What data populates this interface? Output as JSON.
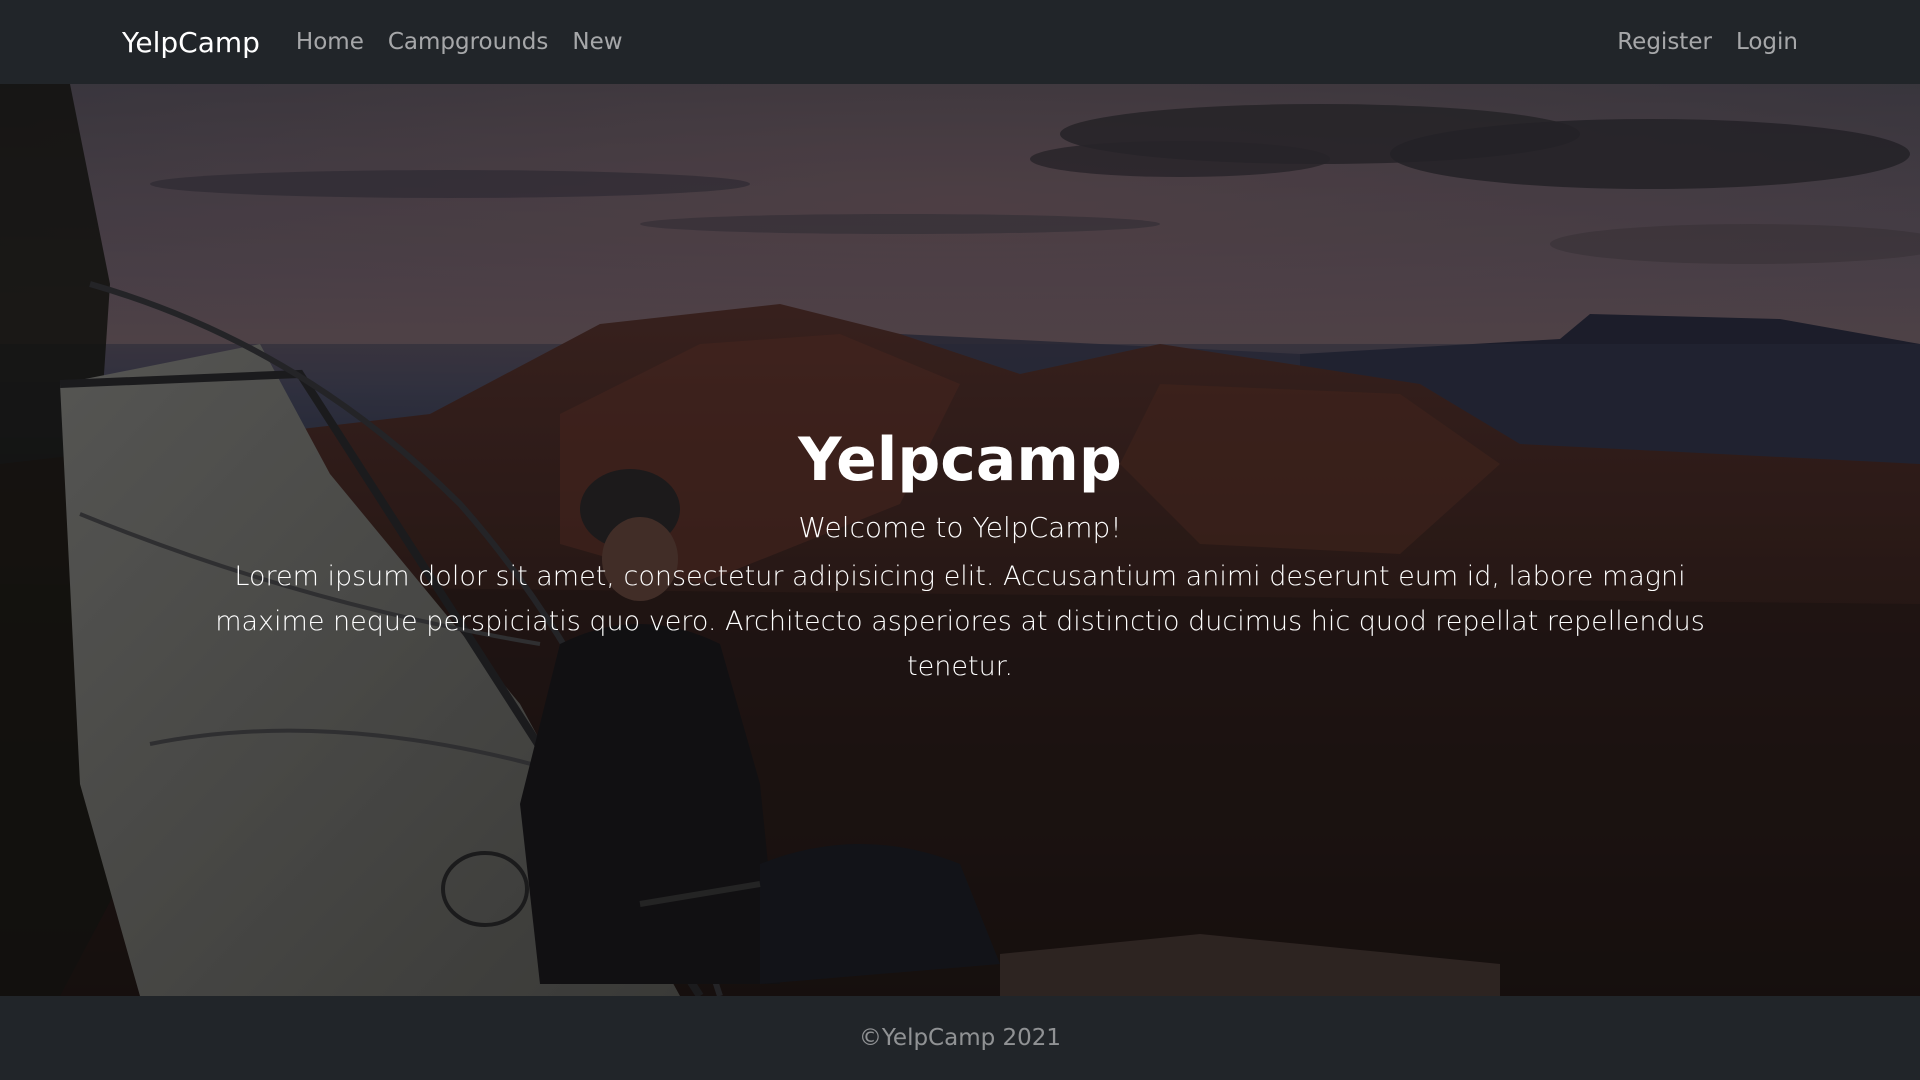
{
  "navbar": {
    "brand": "YelpCamp",
    "links": [
      {
        "label": "Home"
      },
      {
        "label": "Campgrounds"
      },
      {
        "label": "New"
      }
    ],
    "auth_links": [
      {
        "label": "Register"
      },
      {
        "label": "Login"
      }
    ]
  },
  "hero": {
    "title": "Yelpcamp",
    "subtitle": "Welcome to YelpCamp!",
    "text": "Lorem ipsum dolor sit amet, consectetur adipisicing elit. Accusantium animi deserunt eum id, labore magni maxime neque perspiciatis quo vero. Architecto asperiores at distinctio ducimus hic quod repellat repellendus tenetur."
  },
  "footer": {
    "text": "©YelpCamp 2021"
  },
  "colors": {
    "navbar_bg": "#212529",
    "text_primary": "#ffffff"
  }
}
